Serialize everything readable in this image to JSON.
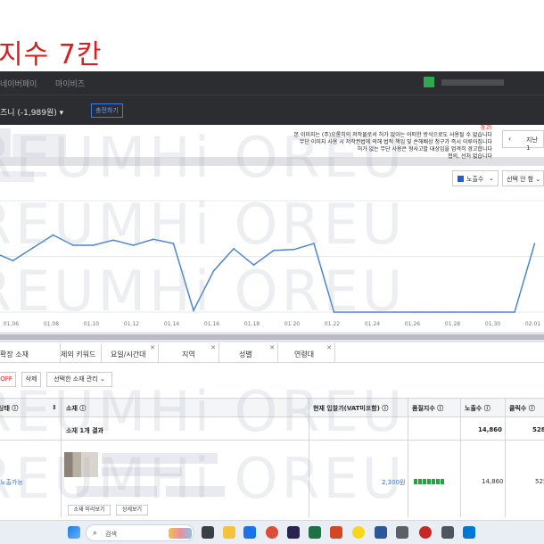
{
  "banner": {
    "title": "지수 7칸"
  },
  "topbar": {
    "links": [
      "네이버페이",
      "마이비즈"
    ]
  },
  "account": {
    "label": "즈니 (-1,989원) ▾",
    "view_button": "충전하기"
  },
  "notice": {
    "warning": "경고!",
    "lines": [
      "본 이미지는 (주)오롬히의 저작물로서 허가 없이는 어떠한 방식으로도 사용될 수 없습니다",
      "무단 이미지 사용 시 저작권법에 의해 법적 책임 및 손해배상 청구가 즉시 이루어집니다",
      "허가 없는 무단 사용은 형사고발 대상임을 엄격히 경고합니다",
      "협의, 선처 없습니다"
    ]
  },
  "date_nav": {
    "prev": "‹",
    "label": "지난 1"
  },
  "metric_dropdown": {
    "label": "노출수",
    "caret": "⌄",
    "color": "#1d5fd6"
  },
  "select_dropdown": {
    "label": "선택 안 함 ⌄"
  },
  "chart_data": {
    "type": "line",
    "color": "#4a86d4",
    "categories": [
      "",
      "",
      "01.08",
      "",
      "01.10",
      "",
      "01.12",
      "",
      "01.14",
      "",
      "01.16",
      "",
      "01.18",
      "",
      "01.20",
      "",
      "01.22",
      "",
      "01.24",
      "",
      "01.26",
      "",
      "01.28",
      "",
      "01.30",
      "",
      "02.01",
      ""
    ],
    "tick_labels": [
      "01.06",
      "01.08",
      "01.10",
      "01.12",
      "01.14",
      "01.16",
      "01.18",
      "01.20",
      "01.22",
      "01.24",
      "01.26",
      "01.28",
      "01.30",
      "02.01"
    ],
    "values": [
      70,
      60,
      75,
      90,
      78,
      78,
      84,
      78,
      85,
      80,
      2,
      48,
      74,
      55,
      72,
      73,
      80,
      0,
      0,
      0,
      0,
      0,
      0,
      0,
      0,
      0,
      0,
      80
    ],
    "ylim": [
      0,
      130
    ],
    "grid": true
  },
  "tabs": [
    {
      "label": "확장 소재",
      "closable": false
    },
    {
      "label": "제외 키워드",
      "closable": false
    },
    {
      "label": "요일/시간대",
      "closable": true
    },
    {
      "label": "지역",
      "closable": true
    },
    {
      "label": "성별",
      "closable": true
    },
    {
      "label": "연령대",
      "closable": true
    }
  ],
  "toolbar": {
    "off": "OFF",
    "delete": "삭제",
    "manage": "선택한 소재 관리 ⌄"
  },
  "table": {
    "headers": [
      "상태 ⓘ",
      "소재 ⓘ",
      "현재 입찰가(VAT미포함) ⓘ",
      "품질지수 ⓘ",
      "노출수 ⓘ",
      "클릭수 ⓘ"
    ],
    "summary": {
      "label": "소재 1개 결과",
      "impressions": "14,860",
      "clicks": "528"
    },
    "row": {
      "status": "노출가능",
      "bid": "2,300원",
      "impressions": "14,860",
      "clicks": "525",
      "btn_edit": "소재 미리보기",
      "btn_more": "상세보기"
    }
  },
  "watermark": "REUMHi OREU",
  "taskbar": {
    "search_label": "검색"
  }
}
